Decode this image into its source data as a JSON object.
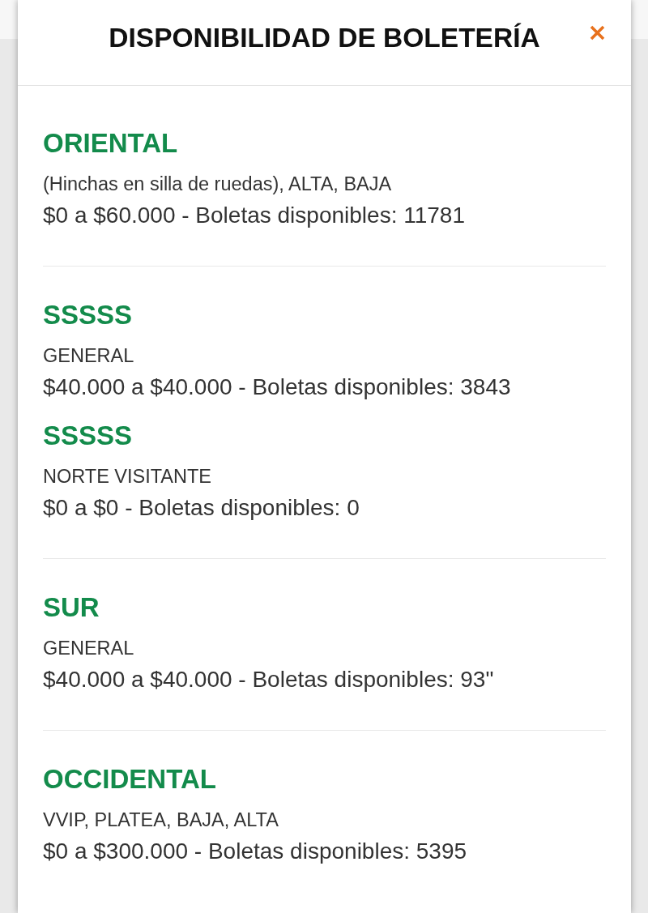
{
  "dialog": {
    "title": "DISPONIBILIDAD DE BOLETERÍA"
  },
  "sections": [
    {
      "entries": [
        {
          "name": "ORIENTAL",
          "zones": "(Hinchas en silla de ruedas), ALTA, BAJA",
          "availability": "$0 a $60.000 - Boletas disponibles: 11781"
        }
      ]
    },
    {
      "entries": [
        {
          "name": "SSSSS",
          "zones": "GENERAL",
          "availability": "$40.000 a $40.000 - Boletas disponibles: 3843"
        },
        {
          "name": "SSSSS",
          "zones": "NORTE VISITANTE",
          "availability": "$0 a $0 - Boletas disponibles: 0"
        }
      ]
    },
    {
      "entries": [
        {
          "name": "SUR",
          "zones": "GENERAL",
          "availability": "$40.000 a $40.000 - Boletas disponibles: 93\""
        }
      ]
    },
    {
      "entries": [
        {
          "name": "OCCIDENTAL",
          "zones": "VVIP, PLATEA, BAJA, ALTA",
          "availability": "$0 a $300.000 - Boletas disponibles: 5395"
        }
      ]
    }
  ]
}
